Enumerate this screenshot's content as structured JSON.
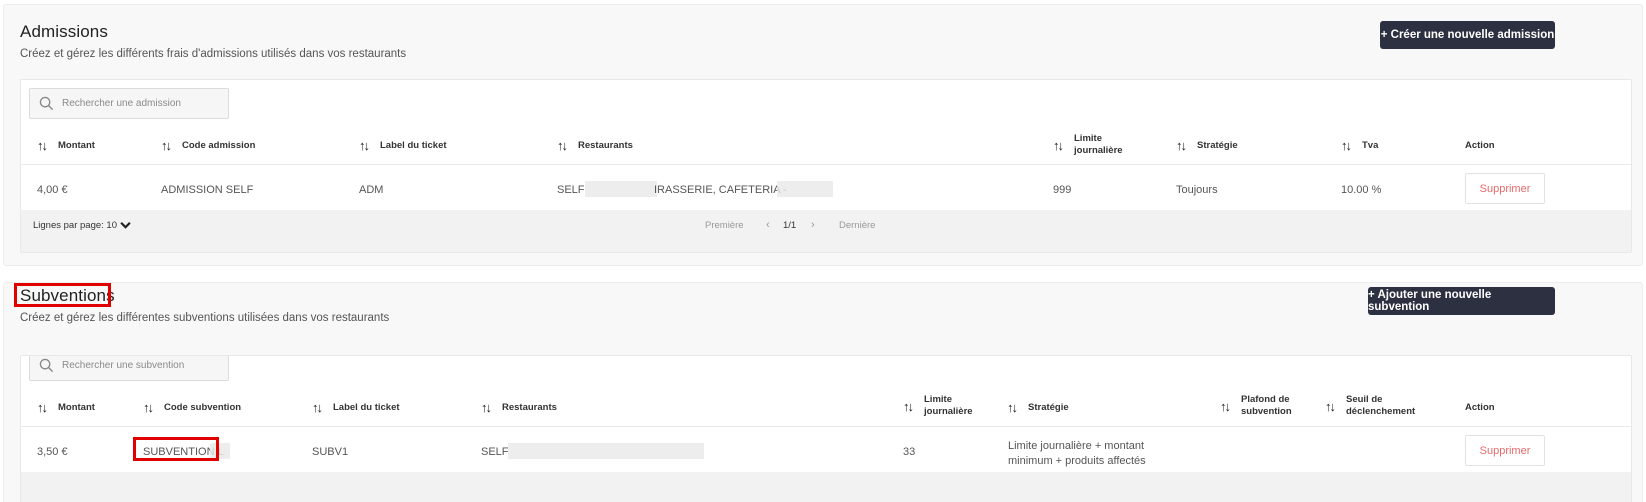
{
  "admissions": {
    "title": "Admissions",
    "description": "Créez et gérez les différents frais d'admissions utilisés dans vos restaurants",
    "create_button": "+ Créer une nouvelle admission",
    "search_placeholder": "Rechercher une admission",
    "columns": {
      "montant": "Montant",
      "code": "Code admission",
      "label": "Label du ticket",
      "restaurants": "Restaurants",
      "limite_1": "Limite",
      "limite_2": "journalière",
      "strategie": "Stratégie",
      "tva": "Tva",
      "action": "Action"
    },
    "rows": [
      {
        "montant": "4,00 €",
        "code": "ADMISSION SELF",
        "label": "ADM",
        "restaurants_a": "SELF",
        "restaurants_b": "IRASSERIE, CAFETERIA -",
        "limite": "999",
        "strategie": "Toujours",
        "tva": "10.00 %",
        "action": "Supprimer"
      }
    ],
    "footer": {
      "rows_per_page_label": "Lignes par page:",
      "rows_per_page_value": "10",
      "first": "Première",
      "page": "1/1",
      "last": "Dernière"
    }
  },
  "subventions": {
    "title": "Subventions",
    "description": "Créez et gérez les différentes subventions utilisées dans vos restaurants",
    "create_button": "+ Ajouter une nouvelle subvention",
    "search_placeholder": "Rechercher une subvention",
    "columns": {
      "montant": "Montant",
      "code": "Code subvention",
      "label": "Label du ticket",
      "restaurants": "Restaurants",
      "limite_1": "Limite",
      "limite_2": "journalière",
      "strategie": "Stratégie",
      "plafond_1": "Plafond de",
      "plafond_2": "subvention",
      "seuil_1": "Seuil de",
      "seuil_2": "déclenchement",
      "action": "Action"
    },
    "rows": [
      {
        "montant": "3,50 €",
        "code": "SUBVENTION L",
        "label": "SUBV1",
        "restaurants": "SELF",
        "limite": "33",
        "strategie_1": "Limite journalière + montant",
        "strategie_2": "minimum + produits affectés",
        "action": "Supprimer"
      }
    ]
  },
  "icons": {
    "search": "search-icon",
    "sort": "sort-arrows-icon",
    "chevron": "chevron-down-icon",
    "prev": "chevron-left-icon",
    "next": "chevron-right-icon"
  },
  "colors": {
    "primary_button": "#2c3040",
    "delete_text": "#e76a6a",
    "highlight": "#e00000"
  }
}
